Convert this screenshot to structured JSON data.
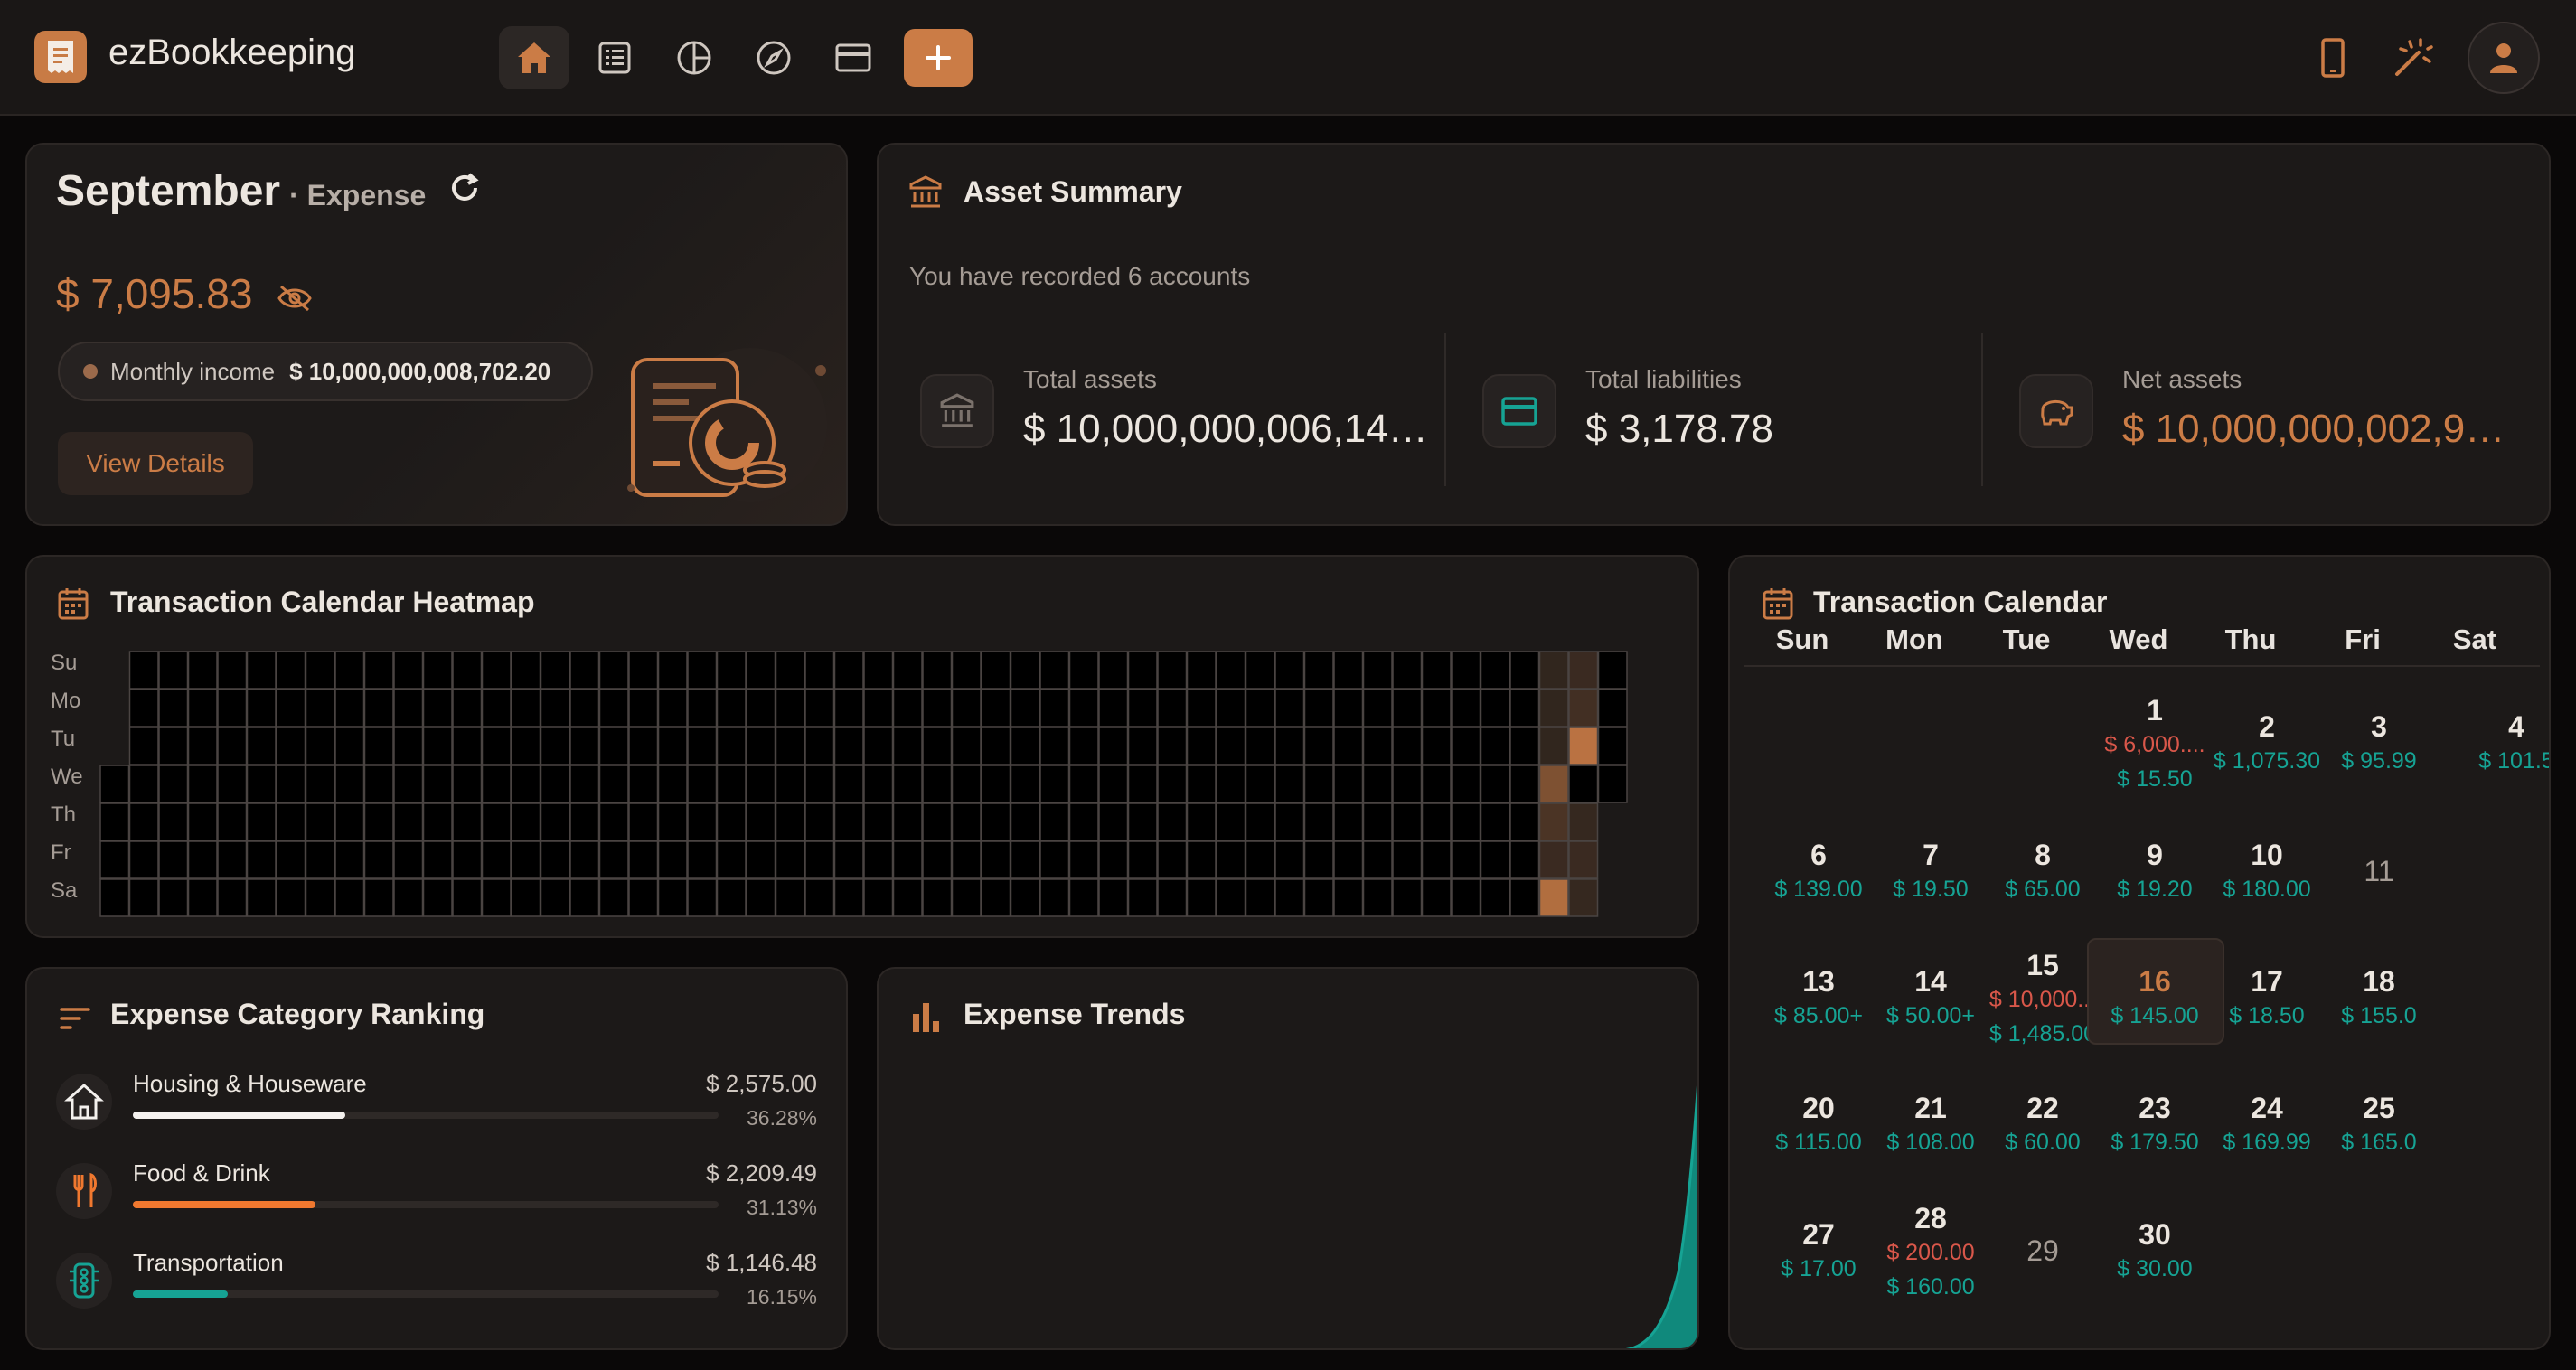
{
  "app": {
    "title": "ezBookkeeping"
  },
  "topbar": {
    "nav": [
      {
        "name": "home-icon",
        "active": true
      },
      {
        "name": "transaction-list-icon",
        "active": false
      },
      {
        "name": "statistics-icon",
        "active": false
      },
      {
        "name": "explore-icon",
        "active": false
      },
      {
        "name": "accounts-icon",
        "active": false
      }
    ],
    "right_icons": [
      "mobile-icon",
      "theme-toggle-icon",
      "user-avatar-icon"
    ]
  },
  "overview": {
    "month": "September",
    "type": "· Expense",
    "amount": "$ 7,095.83",
    "income_label": "Monthly income",
    "income_value": "$ 10,000,000,008,702.20",
    "details_button": "View Details"
  },
  "assets": {
    "title": "Asset Summary",
    "subtitle": "You have recorded 6 accounts",
    "items": [
      {
        "label": "Total assets",
        "value": "$ 10,000,000,006,14…"
      },
      {
        "label": "Total liabilities",
        "value": "$ 3,178.78"
      },
      {
        "label": "Net assets",
        "value": "$ 10,000,000,002,9…"
      }
    ]
  },
  "heatmap": {
    "title": "Transaction Calendar Heatmap",
    "weekdays": [
      "Su",
      "Mo",
      "Tu",
      "We",
      "Th",
      "Fr",
      "Sa"
    ],
    "highlights": [
      {
        "col": 50,
        "row": 0,
        "level": 0.15
      },
      {
        "col": 50,
        "row": 1,
        "level": 0.2
      },
      {
        "col": 50,
        "row": 2,
        "level": 0.9
      },
      {
        "col": 49,
        "row": 0,
        "level": 0.1
      },
      {
        "col": 49,
        "row": 1,
        "level": 0.1
      },
      {
        "col": 49,
        "row": 2,
        "level": 0.1
      },
      {
        "col": 49,
        "row": 3,
        "level": 0.55
      },
      {
        "col": 49,
        "row": 4,
        "level": 0.25
      },
      {
        "col": 49,
        "row": 5,
        "level": 0.15
      },
      {
        "col": 49,
        "row": 6,
        "level": 0.85
      },
      {
        "col": 50,
        "row": 4,
        "level": 0.12
      },
      {
        "col": 50,
        "row": 5,
        "level": 0.15
      },
      {
        "col": 50,
        "row": 6,
        "level": 0.12
      }
    ]
  },
  "calendar": {
    "title": "Transaction Calendar",
    "weekdays": [
      "Sun",
      "Mon",
      "Tue",
      "Wed",
      "Thu",
      "Fri",
      "Sat"
    ],
    "weeks": [
      [
        null,
        null,
        null,
        {
          "day": "1",
          "lines": [
            {
              "t": "$ 6,000....",
              "c": "red"
            },
            {
              "t": "$ 15.50",
              "c": "teal"
            }
          ]
        },
        {
          "day": "2",
          "lines": [
            {
              "t": "$ 1,075.30",
              "c": "teal"
            }
          ]
        },
        {
          "day": "3",
          "lines": [
            {
              "t": "$ 95.99",
              "c": "teal"
            }
          ]
        },
        {
          "day": "4",
          "lines": [
            {
              "t": "$ 101.5",
              "c": "teal"
            }
          ]
        }
      ],
      [
        {
          "day": "6",
          "lines": [
            {
              "t": "$ 139.00",
              "c": "teal"
            }
          ]
        },
        {
          "day": "7",
          "lines": [
            {
              "t": "$ 19.50",
              "c": "teal"
            }
          ]
        },
        {
          "day": "8",
          "lines": [
            {
              "t": "$ 65.00",
              "c": "teal"
            }
          ]
        },
        {
          "day": "9",
          "lines": [
            {
              "t": "$ 19.20",
              "c": "teal"
            }
          ]
        },
        {
          "day": "10",
          "lines": [
            {
              "t": "$ 180.00",
              "c": "teal"
            }
          ]
        },
        {
          "day": "11",
          "lines": [],
          "plain": true
        }
      ],
      [
        {
          "day": "13",
          "lines": [
            {
              "t": "$ 85.00+",
              "c": "teal"
            }
          ]
        },
        {
          "day": "14",
          "lines": [
            {
              "t": "$ 50.00+",
              "c": "teal"
            }
          ]
        },
        {
          "day": "15",
          "lines": [
            {
              "t": "$ 10,000...",
              "c": "red"
            },
            {
              "t": "$ 1,485.00",
              "c": "teal"
            }
          ]
        },
        {
          "day": "16",
          "lines": [
            {
              "t": "$ 145.00",
              "c": "teal"
            }
          ],
          "today": true
        },
        {
          "day": "17",
          "lines": [
            {
              "t": "$ 18.50",
              "c": "teal"
            }
          ]
        },
        {
          "day": "18",
          "lines": [
            {
              "t": "$ 155.0",
              "c": "teal"
            }
          ]
        }
      ],
      [
        {
          "day": "20",
          "lines": [
            {
              "t": "$ 115.00",
              "c": "teal"
            }
          ]
        },
        {
          "day": "21",
          "lines": [
            {
              "t": "$ 108.00",
              "c": "teal"
            }
          ]
        },
        {
          "day": "22",
          "lines": [
            {
              "t": "$ 60.00",
              "c": "teal"
            }
          ]
        },
        {
          "day": "23",
          "lines": [
            {
              "t": "$ 179.50",
              "c": "teal"
            }
          ]
        },
        {
          "day": "24",
          "lines": [
            {
              "t": "$ 169.99",
              "c": "teal"
            }
          ]
        },
        {
          "day": "25",
          "lines": [
            {
              "t": "$ 165.0",
              "c": "teal"
            }
          ]
        }
      ],
      [
        {
          "day": "27",
          "lines": [
            {
              "t": "$ 17.00",
              "c": "teal"
            }
          ]
        },
        {
          "day": "28",
          "lines": [
            {
              "t": "$ 200.00",
              "c": "red"
            },
            {
              "t": "$ 160.00",
              "c": "teal"
            }
          ]
        },
        {
          "day": "29",
          "lines": [],
          "plain": true
        },
        {
          "day": "30",
          "lines": [
            {
              "t": "$ 30.00",
              "c": "teal"
            }
          ]
        }
      ]
    ]
  },
  "ranking": {
    "title": "Expense Category Ranking",
    "items": [
      {
        "name": "Housing & Houseware",
        "amount": "$ 2,575.00",
        "percent": "36.28%",
        "ratio": 0.3628,
        "color": "#f4f1ee",
        "icon": "house-icon"
      },
      {
        "name": "Food & Drink",
        "amount": "$ 2,209.49",
        "percent": "31.13%",
        "ratio": 0.3113,
        "color": "#f0782f",
        "icon": "fork-knife-icon"
      },
      {
        "name": "Transportation",
        "amount": "$ 1,146.48",
        "percent": "16.15%",
        "ratio": 0.1615,
        "color": "#16a394",
        "icon": "traffic-light-icon"
      }
    ]
  },
  "trends": {
    "title": "Expense Trends"
  },
  "colors": {
    "accent": "#cb7c46",
    "teal": "#16a394",
    "red": "#d9574a"
  }
}
